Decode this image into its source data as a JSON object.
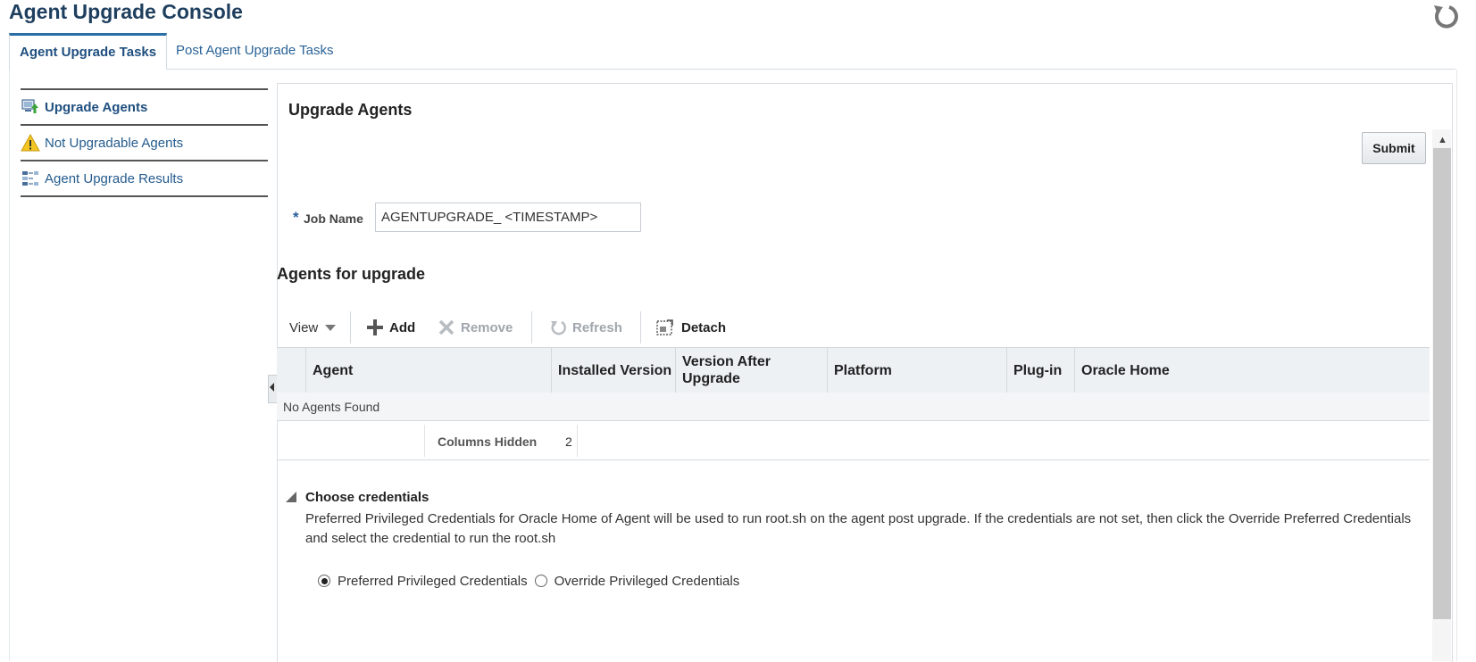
{
  "page": {
    "title": "Agent Upgrade Console"
  },
  "tabs": [
    {
      "label": "Agent Upgrade Tasks",
      "active": true
    },
    {
      "label": "Post Agent Upgrade Tasks",
      "active": false
    }
  ],
  "sidebar": {
    "items": [
      {
        "label": "Upgrade Agents",
        "icon": "upgrade-agents-icon",
        "selected": true
      },
      {
        "label": "Not Upgradable Agents",
        "icon": "warning-icon",
        "selected": false
      },
      {
        "label": "Agent Upgrade Results",
        "icon": "results-icon",
        "selected": false
      }
    ]
  },
  "main": {
    "title": "Upgrade Agents",
    "submit_label": "Submit",
    "job_name": {
      "label": "Job Name",
      "required_marker": "*",
      "value": "AGENTUPGRADE_ <TIMESTAMP>"
    },
    "agents_section_title": "Agents for upgrade",
    "toolbar": {
      "view_label": "View",
      "add_label": "Add",
      "remove_label": "Remove",
      "refresh_label": "Refresh",
      "detach_label": "Detach"
    },
    "table": {
      "columns": [
        "Agent",
        "Installed Version",
        "Version After Upgrade",
        "Platform",
        "Plug-in",
        "Oracle Home"
      ],
      "empty_message": "No Agents Found",
      "columns_hidden_label": "Columns Hidden",
      "columns_hidden_count": "2"
    },
    "credentials": {
      "title": "Choose credentials",
      "description": "Preferred Privileged Credentials for Oracle Home of Agent will be used to run root.sh on the agent post upgrade. If the credentials are not set, then click the Override Preferred Credentials and select the credential to run the root.sh",
      "options": [
        {
          "label": "Preferred Privileged Credentials",
          "selected": true
        },
        {
          "label": "Override Privileged Credentials",
          "selected": false
        }
      ]
    }
  },
  "colors": {
    "title": "#1f3f5f",
    "link": "#245b8d",
    "tab_accent": "#2a6ea8",
    "table_header_bg": "#eef1f4",
    "warning": "#f3c623",
    "add_icon": "#555555",
    "disabled": "#a0a6ac"
  }
}
